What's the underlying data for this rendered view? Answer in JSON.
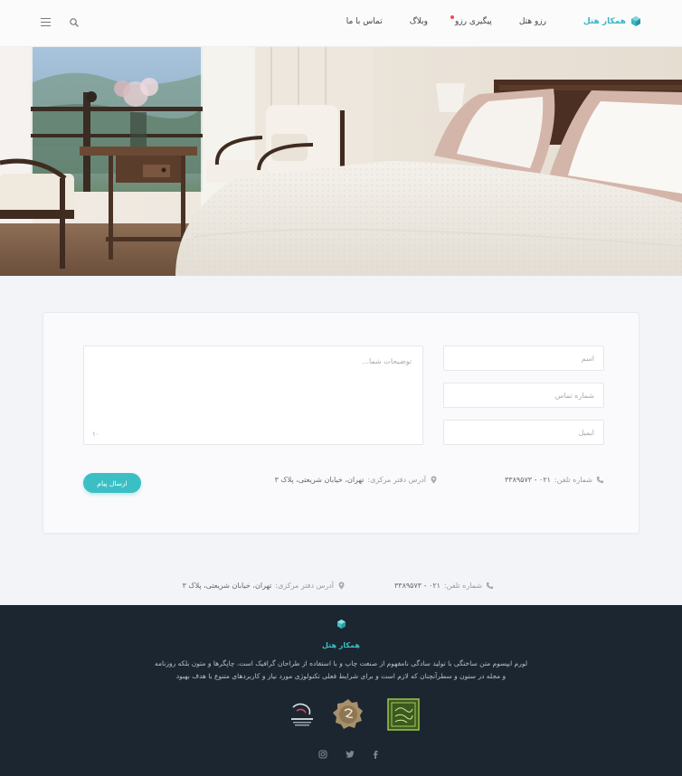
{
  "brand": {
    "name": "همکار هتل"
  },
  "nav": {
    "items": [
      {
        "label": "رزو هتل"
      },
      {
        "label": "پیگیری رزو"
      },
      {
        "label": "وبلاگ"
      },
      {
        "label": "تماس با ما"
      }
    ]
  },
  "form": {
    "name_placeholder": "اسم",
    "phone_placeholder": "شماره تماس",
    "email_placeholder": "ایمیل",
    "message_placeholder": "توضیحات شما...",
    "counter": "۱۰",
    "submit_label": "ارسال پیام"
  },
  "contact": {
    "phone_label": "شماره تلفن:",
    "phone_value": "۰۲۱ - ۳۳۸۹۵۷۳",
    "address_label": "آدرس دفتر مرکزی:",
    "address_value": "تهران، خیابان شریعتی، پلاک ۳"
  },
  "footer": {
    "brand": "همکار هتل",
    "description_line1": "لورم ایپسوم متن ساختگی با تولید سادگی نامفهوم از صنعت چاپ و با استفاده از طراحان گرافیک است. چاپگرها و متون بلکه روزنامه",
    "description_line2": "و مجله در ستون و سطرآنچنان که لازم است و برای شرایط فعلی تکنولوژی مورد نیاز و کاربردهای متنوع با هدف بهبود"
  },
  "colors": {
    "accent": "#3bbfc5",
    "footer_bg": "#1c2631",
    "page_bg": "#f3f4f8",
    "nav_dot": "#e94b5b"
  },
  "icons": {
    "logo": "hexagon-cube-icon",
    "search": "search-icon",
    "menu": "hamburger-menu-icon",
    "phone": "phone-icon",
    "location": "map-pin-icon",
    "social": [
      "facebook-icon",
      "twitter-icon",
      "instagram-icon"
    ]
  }
}
